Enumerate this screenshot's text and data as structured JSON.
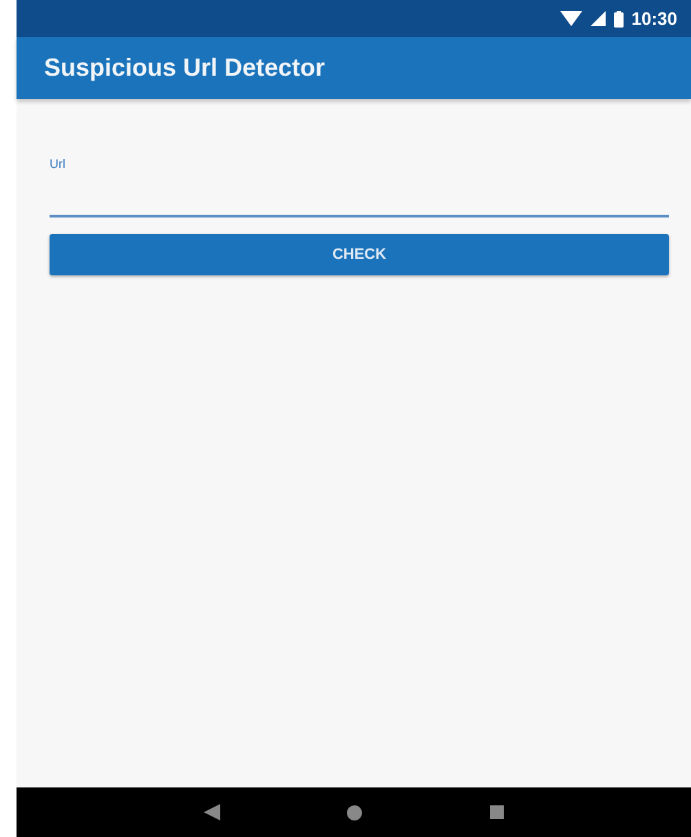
{
  "status_bar": {
    "time": "10:30"
  },
  "app_bar": {
    "title": "Suspicious Url Detector"
  },
  "url_field": {
    "label": "Url"
  },
  "check_button": {
    "label": "CHECK"
  }
}
